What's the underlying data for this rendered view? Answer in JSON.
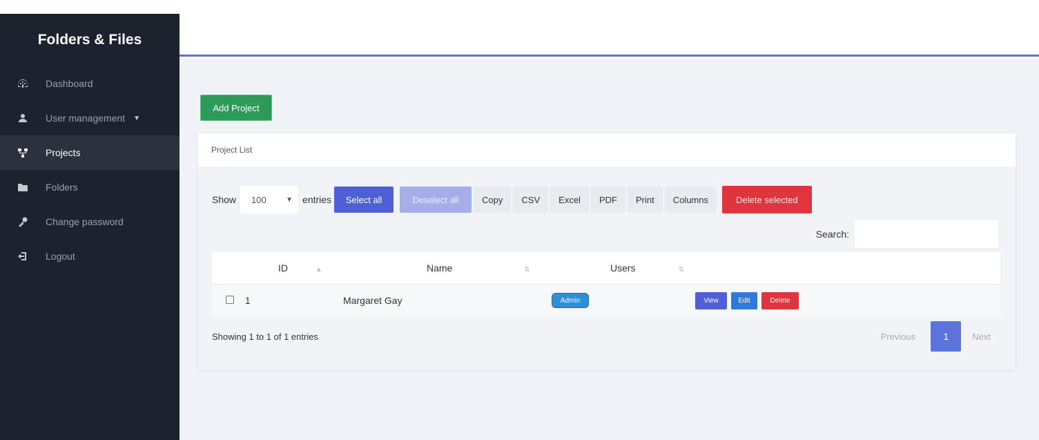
{
  "sidebar": {
    "brand": "Folders & Files",
    "items": [
      {
        "label": "Dashboard",
        "icon": "dashboard-icon"
      },
      {
        "label": "User management",
        "icon": "users-icon",
        "has_caret": true
      },
      {
        "label": "Projects",
        "icon": "projects-icon",
        "active": true
      },
      {
        "label": "Folders",
        "icon": "folder-icon"
      },
      {
        "label": "Change password",
        "icon": "key-icon"
      },
      {
        "label": "Logout",
        "icon": "logout-icon"
      }
    ]
  },
  "main": {
    "add_project_label": "Add Project",
    "card_title": "Project List",
    "toolbar": {
      "show_label": "Show",
      "length_value": "100",
      "entries_label": "entries",
      "select_all": "Select all",
      "deselect_all": "Deselect all",
      "copy": "Copy",
      "csv": "CSV",
      "excel": "Excel",
      "pdf": "PDF",
      "print": "Print",
      "columns": "Columns",
      "delete_selected": "Delete selected"
    },
    "search": {
      "label": "Search:",
      "value": "",
      "placeholder": ""
    },
    "table": {
      "headers": {
        "id": "ID",
        "name": "Name",
        "users": "Users"
      },
      "rows": [
        {
          "id": "1",
          "name": "Margaret Gay",
          "user_badge": "Admin",
          "actions": {
            "view": "View",
            "edit": "Edit",
            "delete": "Delete"
          }
        }
      ]
    },
    "info": "Showing 1 to 1 of 1 entries",
    "pagination": {
      "previous": "Previous",
      "current": "1",
      "next": "Next"
    }
  },
  "colors": {
    "sidebar_bg": "#1d232e",
    "accent_line": "#6272c9",
    "add_button": "#2d9b57",
    "primary": "#4f5fd6",
    "danger": "#e0343f",
    "badge": "#2f8fd8",
    "page_bg": "#eff2f6"
  }
}
